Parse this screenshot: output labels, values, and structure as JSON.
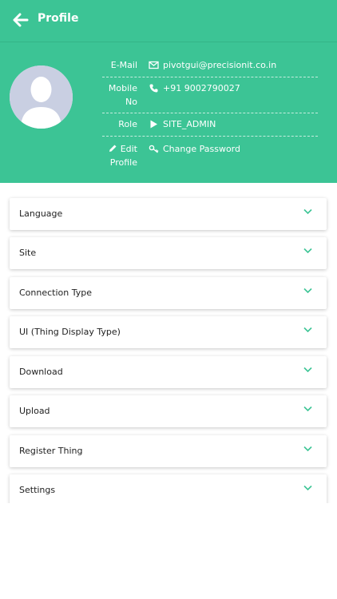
{
  "header": {
    "title": "Profile",
    "back_icon": "arrow-left-icon",
    "background_color": "#3cc495"
  },
  "profile": {
    "avatar_icon": "user-silhouette-icon",
    "email_label": "E-Mail",
    "email": "pivotgui@precisionit.co.in",
    "mobile_label_line1": "Mobile",
    "mobile_label_line2": "No",
    "mobile": "+91 9002790027",
    "role_label": "Role",
    "role": "SITE_ADMIN",
    "edit_label_line1": "Edit",
    "edit_label_line2": "Profile",
    "change_password": "Change Password"
  },
  "sections": [
    {
      "label": "Language"
    },
    {
      "label": "Site"
    },
    {
      "label": "Connection Type"
    },
    {
      "label": "UI (Thing Display Type)"
    },
    {
      "label": "Download"
    },
    {
      "label": "Upload"
    },
    {
      "label": "Register Thing"
    },
    {
      "label": "Settings"
    }
  ],
  "colors": {
    "accent": "#3cc495",
    "chevron": "#3cc495"
  }
}
